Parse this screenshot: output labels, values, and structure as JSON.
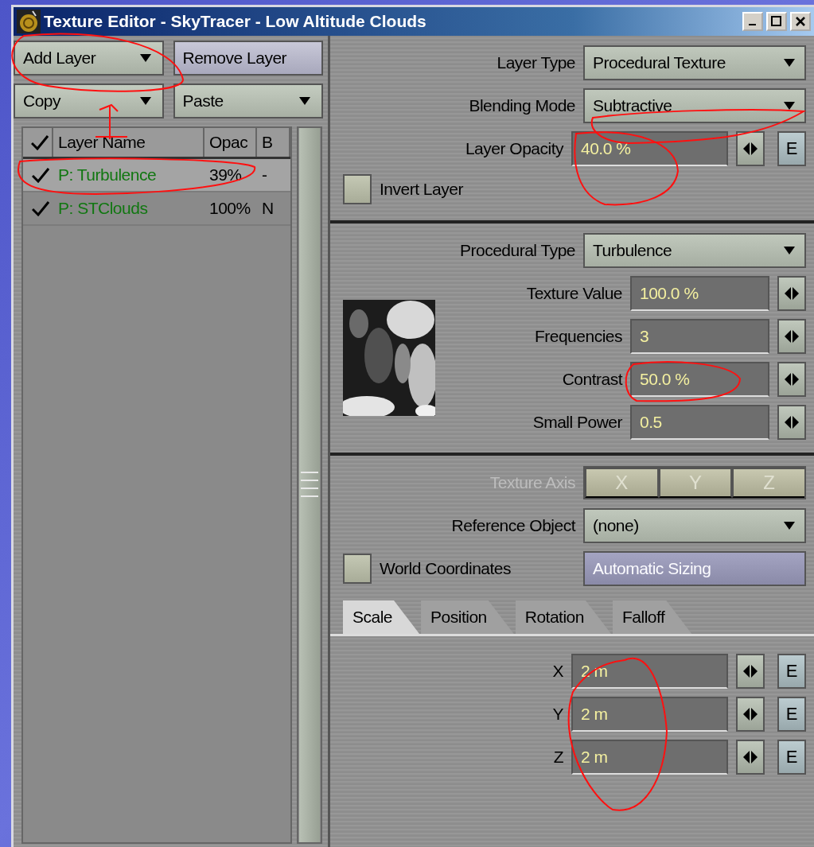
{
  "window": {
    "title": "Texture Editor - SkyTracer - Low Altitude Clouds"
  },
  "layer_buttons": [
    {
      "label": "Add Layer",
      "kind": "dropdown"
    },
    {
      "label": "Remove Layer",
      "kind": "button"
    },
    {
      "label": "Copy",
      "kind": "dropdown"
    },
    {
      "label": "Paste",
      "kind": "dropdown"
    }
  ],
  "layer_table": {
    "columns": [
      "Layer Name",
      "Opac",
      "B"
    ],
    "rows": [
      {
        "checked": true,
        "name": "P: Turbulence",
        "opacity": "39%",
        "blend": "-",
        "selected": true
      },
      {
        "checked": true,
        "name": "P: STClouds",
        "opacity": "100%",
        "blend": "N",
        "selected": false
      }
    ]
  },
  "layer_settings": {
    "layer_type": {
      "label": "Layer Type",
      "value": "Procedural Texture"
    },
    "blending_mode": {
      "label": "Blending Mode",
      "value": "Subtractive"
    },
    "layer_opacity": {
      "label": "Layer Opacity",
      "value": "40.0 %",
      "envelope": "E"
    },
    "invert_layer": {
      "label": "Invert Layer",
      "checked": false
    }
  },
  "procedural": {
    "type": {
      "label": "Procedural Type",
      "value": "Turbulence"
    },
    "fields": [
      {
        "label": "Texture Value",
        "value": "100.0 %"
      },
      {
        "label": "Frequencies",
        "value": "3"
      },
      {
        "label": "Contrast",
        "value": "50.0 %"
      },
      {
        "label": "Small Power",
        "value": "0.5"
      }
    ]
  },
  "mapping": {
    "texture_axis": {
      "label": "Texture Axis",
      "disabled": true,
      "options": [
        {
          "label": "X",
          "selected": false
        },
        {
          "label": "Y",
          "selected": false
        },
        {
          "label": "Z",
          "selected": false
        }
      ]
    },
    "reference_object": {
      "label": "Reference Object",
      "value": "(none)"
    },
    "world_coordinates": {
      "label": "World Coordinates",
      "checked": false
    },
    "automatic_sizing": {
      "label": "Automatic Sizing",
      "disabled": true
    },
    "tabs": [
      {
        "label": "Scale",
        "selected": true
      },
      {
        "label": "Position",
        "selected": false
      },
      {
        "label": "Rotation",
        "selected": false
      },
      {
        "label": "Falloff",
        "selected": false
      }
    ],
    "fields": [
      {
        "label": "X",
        "value": "2 m",
        "envelope": "E"
      },
      {
        "label": "Y",
        "value": "2 m",
        "envelope": "E"
      },
      {
        "label": "Z",
        "value": "2 m",
        "envelope": "E"
      }
    ]
  }
}
